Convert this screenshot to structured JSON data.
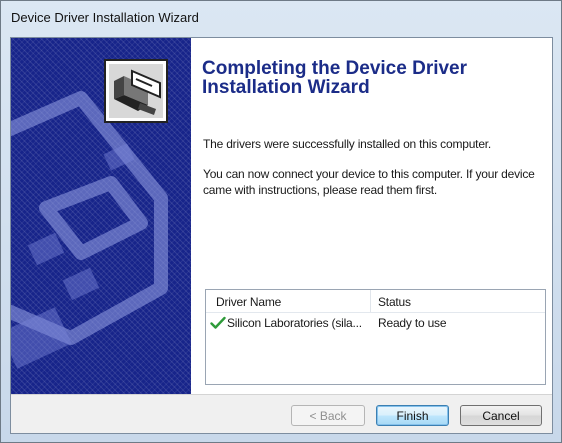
{
  "window": {
    "title": "Device Driver Installation Wizard"
  },
  "banner": {
    "icon": "driver-install-icon",
    "background_color": "#17248a"
  },
  "content": {
    "heading": "Completing the Device Driver Installation Wizard",
    "success_message": "The drivers were successfully installed on this computer.",
    "instructions": "You can now connect your device to this computer. If your device came with instructions, please read them first."
  },
  "driver_list": {
    "columns": [
      "Driver Name",
      "Status"
    ],
    "rows": [
      {
        "icon": "checkmark-icon",
        "name": "Silicon Laboratories (sila...",
        "status": "Ready to use"
      }
    ]
  },
  "buttons": {
    "back": "< Back",
    "finish": "Finish",
    "cancel": "Cancel"
  },
  "colors": {
    "heading": "#1b2c88",
    "check": "#2e9b3a"
  }
}
